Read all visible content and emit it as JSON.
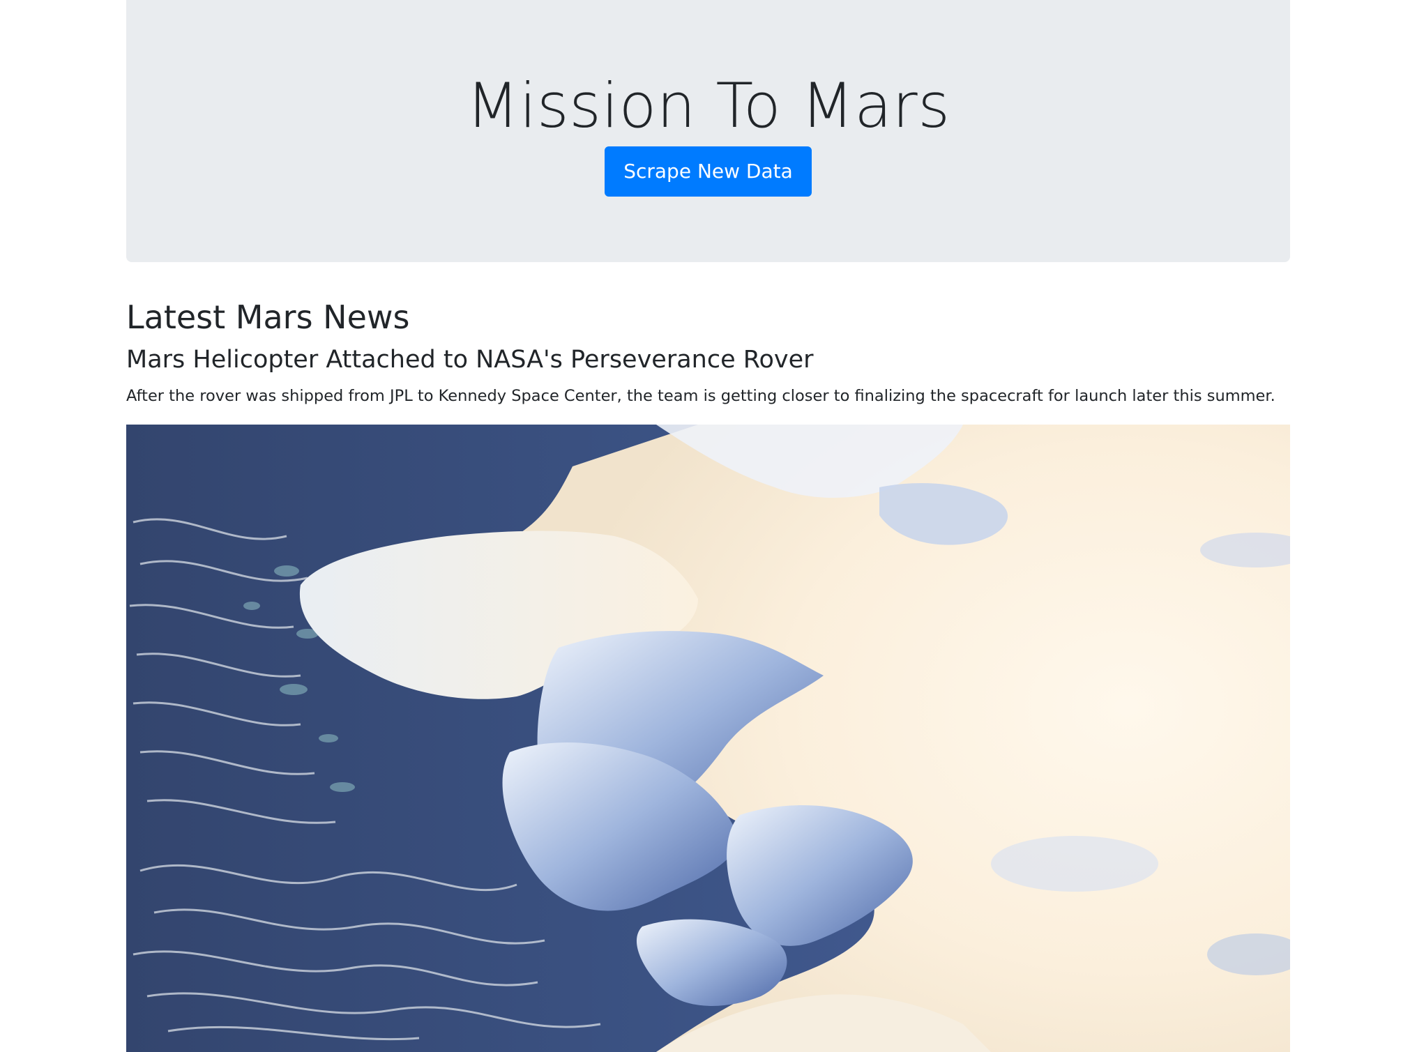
{
  "header": {
    "title": "Mission To Mars",
    "scrape_button_label": "Scrape New Data",
    "colors": {
      "background": "#e9ecef",
      "button": "#007bff"
    }
  },
  "news": {
    "section_title": "Latest Mars News",
    "headline": "Mars Helicopter Attached to NASA's Perseverance Rover",
    "teaser": "After the rover was shipped from JPL to Kennedy Space Center, the team is getting closer to finalizing the spacecraft for launch later this summer."
  },
  "featured_image": {
    "subject": "aerial-snow-glacier-landscape"
  }
}
